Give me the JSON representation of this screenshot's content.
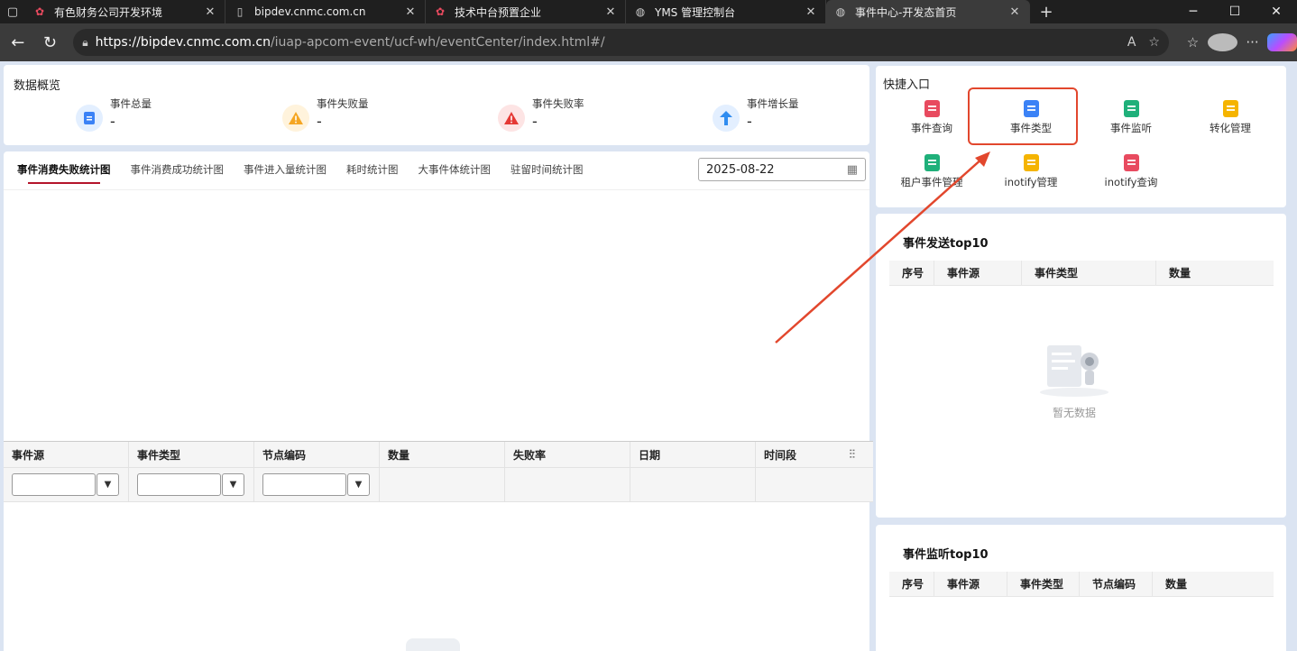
{
  "browser": {
    "tabs": [
      {
        "title": "有色财务公司开发环境",
        "icon": "app-icon",
        "active": false
      },
      {
        "title": "bipdev.cnmc.com.cn",
        "icon": "page-icon",
        "active": false
      },
      {
        "title": "技术中台预置企业",
        "icon": "app-icon",
        "active": false
      },
      {
        "title": "YMS 管理控制台",
        "icon": "globe-icon",
        "active": false
      },
      {
        "title": "事件中心-开发态首页",
        "icon": "globe-icon",
        "active": true
      }
    ],
    "url_host": "https://bipdev.cnmc.com.cn",
    "url_path": "/iuap-apcom-event/ucf-wh/eventCenter/index.html#/"
  },
  "overview": {
    "title": "数据概览",
    "stats": [
      {
        "label": "事件总量",
        "value": "-",
        "icon": "document-icon",
        "color": "#3b82f6",
        "bg": "#e3efff"
      },
      {
        "label": "事件失败量",
        "value": "-",
        "icon": "warning-icon",
        "color": "#f5a623",
        "bg": "#fff3dc"
      },
      {
        "label": "事件失败率",
        "value": "-",
        "icon": "alert-icon",
        "color": "#e53935",
        "bg": "#fde4e4"
      },
      {
        "label": "事件增长量",
        "value": "-",
        "icon": "arrow-up-icon",
        "color": "#2f8cf0",
        "bg": "#e3efff"
      }
    ]
  },
  "chart_tabs": [
    "事件消费失败统计图",
    "事件消费成功统计图",
    "事件进入量统计图",
    "耗时统计图",
    "大事件体统计图",
    "驻留时间统计图"
  ],
  "date": "2025-08-22",
  "grid": {
    "columns": [
      "事件源",
      "事件类型",
      "节点编码",
      "数量",
      "失败率",
      "日期",
      "时间段"
    ]
  },
  "quick_entry": {
    "title": "快捷入口",
    "items": [
      {
        "label": "事件查询",
        "color": "#e84a5f"
      },
      {
        "label": "事件类型",
        "color": "#3b82f6"
      },
      {
        "label": "事件监听",
        "color": "#1fb07a"
      },
      {
        "label": "转化管理",
        "color": "#f5b400"
      },
      {
        "label": "租户事件管理",
        "color": "#1fb07a"
      },
      {
        "label": "inotify管理",
        "color": "#f5b400"
      },
      {
        "label": "inotify查询",
        "color": "#e84a5f"
      }
    ]
  },
  "send_top10": {
    "title": "事件发送top10",
    "columns": [
      "序号",
      "事件源",
      "事件类型",
      "数量"
    ],
    "empty_text": "暂无数据"
  },
  "listen_top10": {
    "title": "事件监听top10",
    "columns": [
      "序号",
      "事件源",
      "事件类型",
      "节点编码",
      "数量"
    ]
  },
  "annotation_color": "#e2472d"
}
